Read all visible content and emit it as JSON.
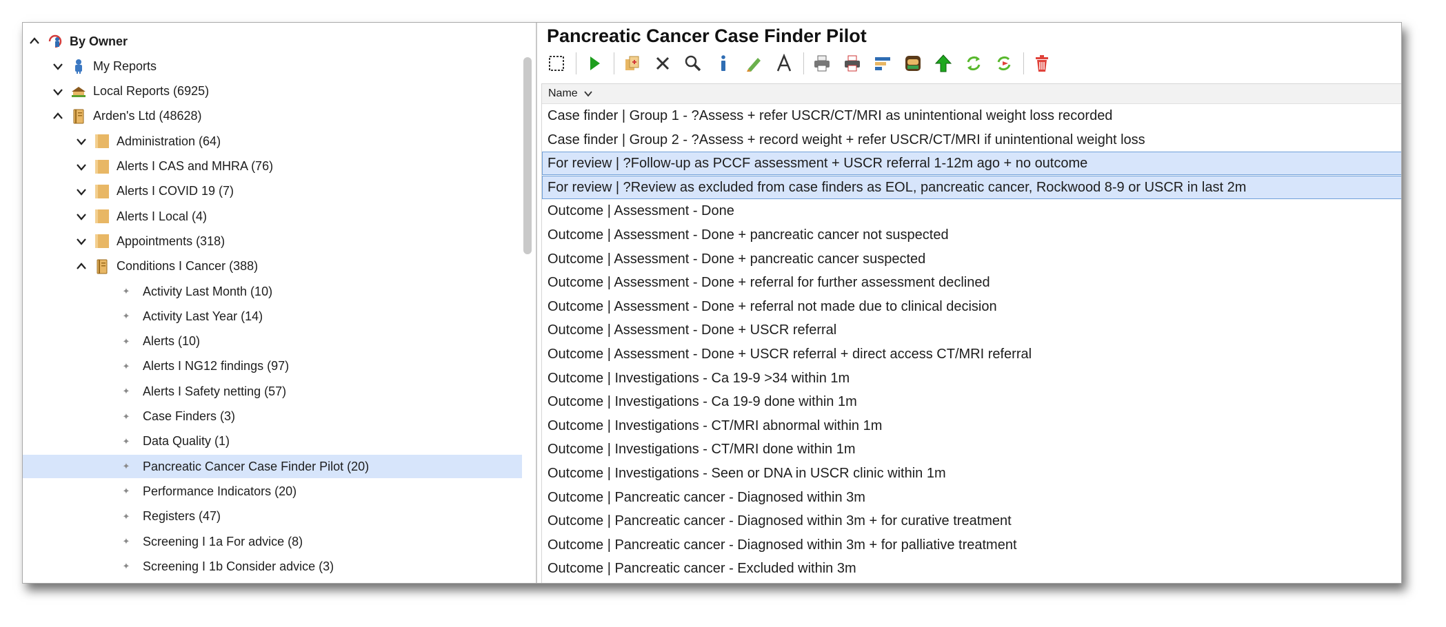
{
  "tree": {
    "items": [
      {
        "label": "By Owner",
        "chevron": "up",
        "icon": "owner-icon",
        "indent": 0,
        "bold": true
      },
      {
        "label": "My Reports",
        "chevron": "down",
        "icon": "person-icon",
        "indent": 1
      },
      {
        "label": "Local Reports (6925)",
        "chevron": "down",
        "icon": "local-reports-icon",
        "indent": 1
      },
      {
        "label": "Arden's Ltd (48628)",
        "chevron": "up",
        "icon": "book-icon",
        "indent": 1
      },
      {
        "label": "Administration (64)",
        "chevron": "down",
        "icon": "folder-icon",
        "indent": 2
      },
      {
        "label": "Alerts I CAS and MHRA (76)",
        "chevron": "down",
        "icon": "folder-icon",
        "indent": 2
      },
      {
        "label": "Alerts I COVID 19 (7)",
        "chevron": "down",
        "icon": "folder-icon",
        "indent": 2
      },
      {
        "label": "Alerts I Local (4)",
        "chevron": "down",
        "icon": "folder-icon",
        "indent": 2
      },
      {
        "label": "Appointments (318)",
        "chevron": "down",
        "icon": "folder-icon",
        "indent": 2
      },
      {
        "label": "Conditions I Cancer (388)",
        "chevron": "up",
        "icon": "book-icon",
        "indent": 2
      },
      {
        "label": "Activity Last Month (10)",
        "indent": 3
      },
      {
        "label": "Activity Last Year (14)",
        "indent": 3
      },
      {
        "label": "Alerts (10)",
        "indent": 3
      },
      {
        "label": "Alerts I NG12 findings (97)",
        "indent": 3
      },
      {
        "label": "Alerts I Safety netting (57)",
        "indent": 3
      },
      {
        "label": "Case Finders (3)",
        "indent": 3
      },
      {
        "label": "Data Quality (1)",
        "indent": 3
      },
      {
        "label": "Pancreatic Cancer Case Finder Pilot (20)",
        "indent": 3,
        "selected": true
      },
      {
        "label": "Performance Indicators (20)",
        "indent": 3
      },
      {
        "label": "Registers (47)",
        "indent": 3
      },
      {
        "label": "Screening I 1a For advice (8)",
        "indent": 3
      },
      {
        "label": "Screening I 1b Consider advice (3)",
        "indent": 3
      }
    ]
  },
  "main": {
    "title": "Pancreatic Cancer Case Finder Pilot",
    "toolbar": [
      "select-icon",
      "sep",
      "run-icon",
      "sep",
      "copy-icon",
      "delete-icon",
      "search-icon",
      "info-icon",
      "edit-icon",
      "font-icon",
      "sep",
      "print-icon",
      "print-preview-icon",
      "report-icon",
      "export-icon",
      "upload-icon",
      "refresh-icon",
      "refresh-forward-icon",
      "sep",
      "trash-icon"
    ],
    "column_header": "Name",
    "rows": [
      {
        "label": "Case finder | Group 1 - ?Assess + refer USCR/CT/MRI as unintentional weight loss recorded"
      },
      {
        "label": "Case finder | Group 2 - ?Assess + record weight + refer USCR/CT/MRI if unintentional weight loss"
      },
      {
        "label": "For review | ?Follow-up as PCCF assessment + USCR referral 1-12m ago + no outcome",
        "selected": true
      },
      {
        "label": "For review | ?Review as excluded from case finders as EOL, pancreatic cancer, Rockwood 8-9 or USCR in last 2m",
        "selected": true
      },
      {
        "label": "Outcome | Assessment - Done"
      },
      {
        "label": "Outcome | Assessment - Done + pancreatic cancer not suspected"
      },
      {
        "label": "Outcome | Assessment - Done + pancreatic cancer suspected"
      },
      {
        "label": "Outcome | Assessment - Done + referral for further assessment declined"
      },
      {
        "label": "Outcome | Assessment - Done + referral not made due to clinical decision"
      },
      {
        "label": "Outcome | Assessment - Done + USCR referral"
      },
      {
        "label": "Outcome | Assessment - Done + USCR referral + direct access CT/MRI referral"
      },
      {
        "label": "Outcome | Investigations - Ca 19-9 >34 within 1m"
      },
      {
        "label": "Outcome | Investigations - Ca 19-9 done within 1m"
      },
      {
        "label": "Outcome | Investigations - CT/MRI abnormal within 1m"
      },
      {
        "label": "Outcome | Investigations - CT/MRI done within 1m"
      },
      {
        "label": "Outcome | Investigations - Seen or DNA in USCR clinic within 1m"
      },
      {
        "label": "Outcome | Pancreatic cancer - Diagnosed within 3m"
      },
      {
        "label": "Outcome | Pancreatic cancer - Diagnosed within 3m + for curative treatment"
      },
      {
        "label": "Outcome | Pancreatic cancer - Diagnosed within 3m + for palliative treatment"
      },
      {
        "label": "Outcome | Pancreatic cancer - Excluded within 3m"
      }
    ]
  },
  "colors": {
    "selection_bg": "#d7e5fb",
    "selection_border": "#6f9fd8",
    "folder": "#e8b765",
    "run_green": "#1e9e1e",
    "trash_red": "#e0423a"
  }
}
